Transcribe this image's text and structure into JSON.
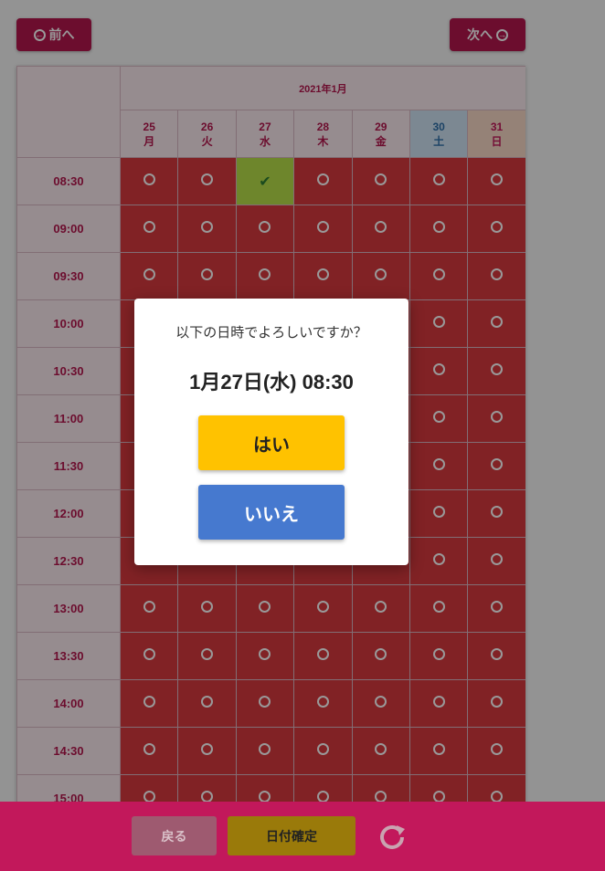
{
  "nav": {
    "prev_label": "前へ",
    "next_label": "次へ"
  },
  "calendar": {
    "month": "2021年1月",
    "days": [
      {
        "date": "25",
        "dow": "月"
      },
      {
        "date": "26",
        "dow": "火"
      },
      {
        "date": "27",
        "dow": "水"
      },
      {
        "date": "28",
        "dow": "木"
      },
      {
        "date": "29",
        "dow": "金"
      },
      {
        "date": "30",
        "dow": "土"
      },
      {
        "date": "31",
        "dow": "日"
      }
    ],
    "times": [
      "08:30",
      "09:00",
      "09:30",
      "10:00",
      "10:30",
      "11:00",
      "11:30",
      "12:00",
      "12:30",
      "13:00",
      "13:30",
      "14:00",
      "14:30",
      "15:00"
    ],
    "selected": {
      "time": "08:30",
      "date": "27"
    }
  },
  "dialog": {
    "question": "以下の日時でよろしいですか？",
    "datetime": "1月27日(水) 08:30",
    "yes_label": "はい",
    "no_label": "いいえ"
  },
  "footer": {
    "back_label": "戻る",
    "confirm_label": "日付確定"
  }
}
